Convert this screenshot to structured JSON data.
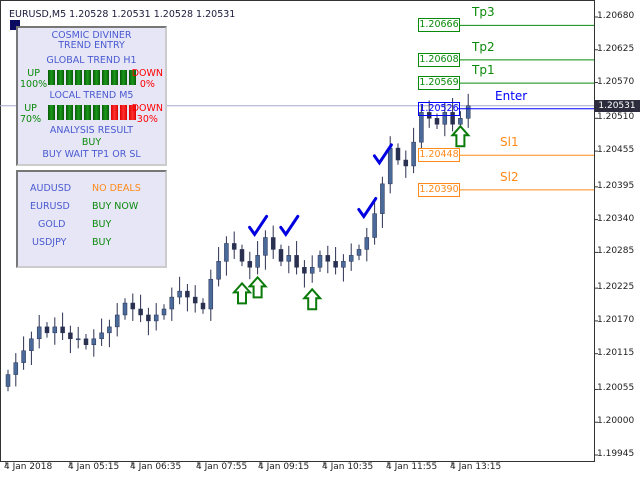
{
  "window": {
    "title": "EURUSD,M5  1.20528 1.20531 1.20528 1.20531"
  },
  "panel": {
    "title1": "COSMIC DIVINER",
    "title2": "TREND ENTRY",
    "global_label": "GLOBAL TREND H1",
    "global_up": "UP",
    "global_up_pct": "100%",
    "global_down": "DOWN",
    "global_down_pct": "0%",
    "global_up_fraction": 1.0,
    "local_label": "LOCAL TREND M5",
    "local_up": "UP",
    "local_up_pct": "70%",
    "local_down": "DOWN",
    "local_down_pct": "30%",
    "local_up_fraction": 0.7,
    "analysis_label": "ANALYSIS RESULT",
    "analysis_value": "BUY",
    "analysis_note": "BUY WAIT TP1 OR SL"
  },
  "deals": [
    {
      "symbol": "AUDUSD",
      "status": "NO DEALS",
      "color": "#ff8a1a"
    },
    {
      "symbol": "EURUSD",
      "status": "BUY NOW",
      "color": "#0a8a0a"
    },
    {
      "symbol": "GOLD",
      "status": "BUY",
      "color": "#0a8a0a"
    },
    {
      "symbol": "USDJPY",
      "status": "BUY",
      "color": "#0a8a0a"
    }
  ],
  "levels": [
    {
      "name": "Tp3",
      "value": "1.20666",
      "price": 1.20666,
      "color": "#0a8a0a"
    },
    {
      "name": "Tp2",
      "value": "1.20608",
      "price": 1.20608,
      "color": "#0a8a0a"
    },
    {
      "name": "Tp1",
      "value": "1.20569",
      "price": 1.20569,
      "color": "#0a8a0a"
    },
    {
      "name": "Enter",
      "value": "1.20526",
      "price": 1.20526,
      "color": "#0000ff"
    },
    {
      "name": "Sl1",
      "value": "1.20448",
      "price": 1.20448,
      "color": "#ff8a1a"
    },
    {
      "name": "Sl2",
      "value": "1.20390",
      "price": 1.2039,
      "color": "#ff8a1a"
    }
  ],
  "current_price": "1.20531",
  "price_axis": [
    "1.20680",
    "1.20625",
    "1.20570",
    "1.20510",
    "1.20455",
    "1.20395",
    "1.20340",
    "1.20285",
    "1.20225",
    "1.20170",
    "1.20115",
    "1.20055",
    "1.20000",
    "1.19945"
  ],
  "time_axis": [
    "4 Jan 2018",
    "4 Jan 05:15",
    "4 Jan 06:35",
    "4 Jan 07:55",
    "4 Jan 09:15",
    "4 Jan 10:35",
    "4 Jan 11:55",
    "4 Jan 13:15"
  ],
  "chart_data": {
    "type": "candlestick",
    "symbol": "EURUSD",
    "timeframe": "M5",
    "ylim": [
      1.19945,
      1.2068
    ],
    "closes": [
      1.2008,
      1.201,
      1.2012,
      1.2014,
      1.2016,
      1.2015,
      1.2016,
      1.2015,
      1.2014,
      1.2014,
      1.2013,
      1.2014,
      1.2015,
      1.2016,
      1.2018,
      1.202,
      1.2019,
      1.2018,
      1.2017,
      1.2018,
      1.2019,
      1.2021,
      1.2022,
      1.2021,
      1.202,
      1.2019,
      1.2024,
      1.2027,
      1.203,
      1.2029,
      1.2027,
      1.2026,
      1.2028,
      1.2031,
      1.2029,
      1.2027,
      1.2028,
      1.2026,
      1.2025,
      1.2026,
      1.2028,
      1.2027,
      1.2026,
      1.2027,
      1.2028,
      1.2029,
      1.2031,
      1.2035,
      1.204,
      1.2046,
      1.2044,
      1.2043,
      1.2047,
      1.2052,
      1.2051,
      1.205,
      1.2052,
      1.205,
      1.2051,
      1.20531
    ],
    "buy_checkmarks_at_candle": [
      32,
      36,
      46,
      48
    ],
    "up_arrows_at_candle": [
      30,
      32,
      39,
      58
    ]
  }
}
